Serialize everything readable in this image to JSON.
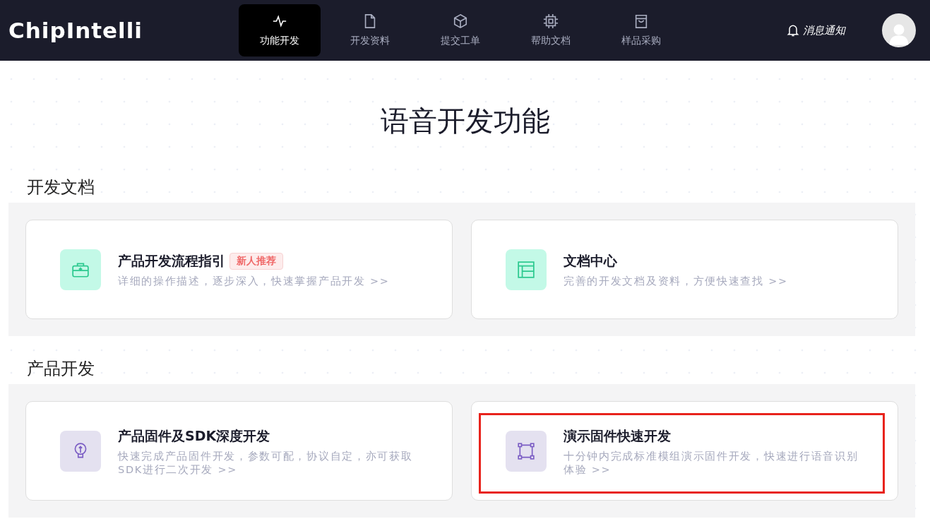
{
  "header": {
    "logo": "ChipIntelli",
    "nav": [
      {
        "label": "功能开发",
        "kind": "pulse",
        "selected": true
      },
      {
        "label": "开发资料",
        "kind": "file",
        "selected": false
      },
      {
        "label": "提交工单",
        "kind": "cube",
        "selected": false
      },
      {
        "label": "帮助文档",
        "kind": "chip",
        "selected": false
      },
      {
        "label": "样品采购",
        "kind": "bag",
        "selected": false
      }
    ],
    "notification": "消息通知"
  },
  "page_title": "语音开发功能",
  "sections": [
    {
      "title": "开发文档",
      "cards": [
        {
          "title": "产品开发流程指引",
          "badge": "新人推荐",
          "description": "详细的操作描述，逐步深入，快速掌握产品开发 >>",
          "kind": "toolbox",
          "highlighted": false
        },
        {
          "title": "文档中心",
          "description": "完善的开发文档及资料，方便快速查找 >>",
          "kind": "layout",
          "highlighted": false
        }
      ]
    },
    {
      "title": "产品开发",
      "cards": [
        {
          "title": "产品固件及SDK深度开发",
          "description": "快速完成产品固件开发，参数可配，协议自定，亦可获取SDK进行二次开发 >>",
          "kind": "bulb",
          "highlighted": false
        },
        {
          "title": "演示固件快速开发",
          "description": "十分钟内完成标准模组演示固件开发，快速进行语音识别体验 >>",
          "kind": "frame",
          "highlighted": true
        }
      ]
    }
  ]
}
